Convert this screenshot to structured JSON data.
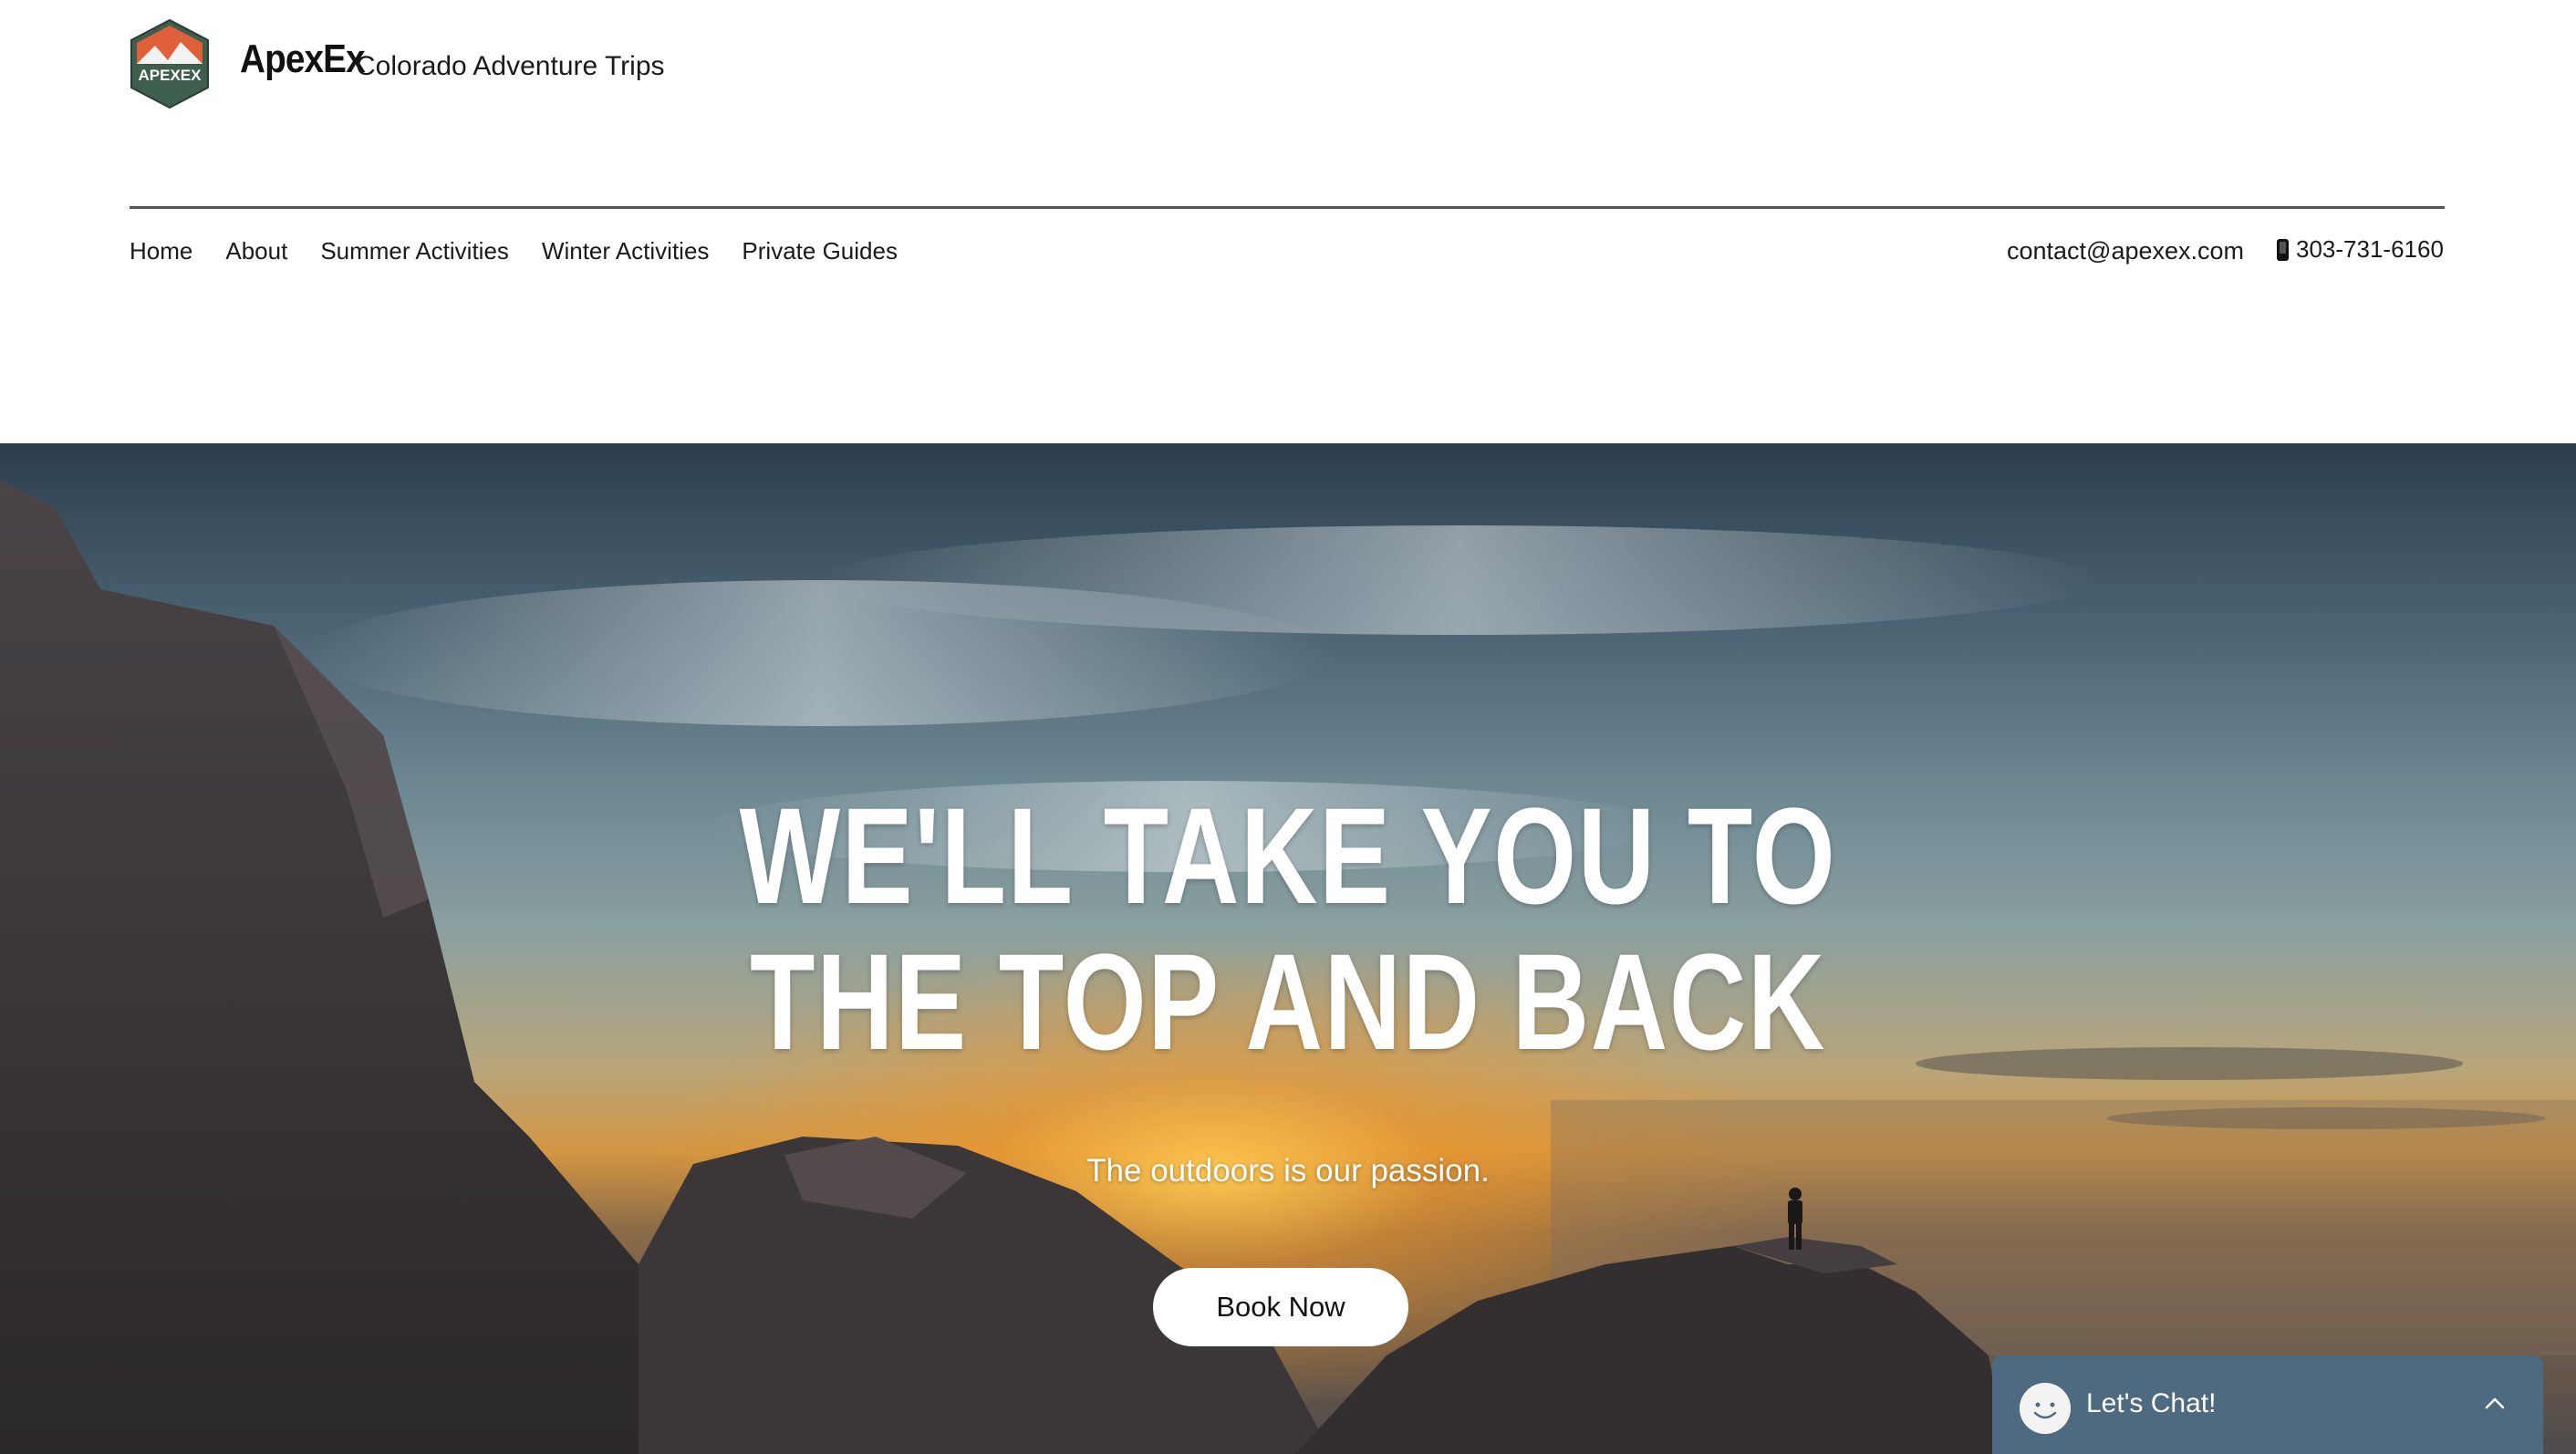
{
  "header": {
    "logo_text": "APEXEX",
    "brand_name": "ApexEx",
    "tagline": "Colorado Adventure Trips"
  },
  "nav": {
    "items": [
      {
        "label": "Home"
      },
      {
        "label": "About"
      },
      {
        "label": "Summer Activities"
      },
      {
        "label": "Winter Activities"
      },
      {
        "label": "Private Guides"
      }
    ]
  },
  "contact": {
    "email": "contact@apexex.com",
    "phone": "303-731-6160",
    "phone_icon": "mobile-phone-icon"
  },
  "hero": {
    "title_line1": "WE'LL TAKE YOU TO",
    "title_line2": "THE TOP AND BACK",
    "subtitle": "The outdoors is our passion.",
    "cta_label": "Book Now"
  },
  "chat": {
    "label": "Let's Chat!",
    "accent": "#4d6a80"
  }
}
